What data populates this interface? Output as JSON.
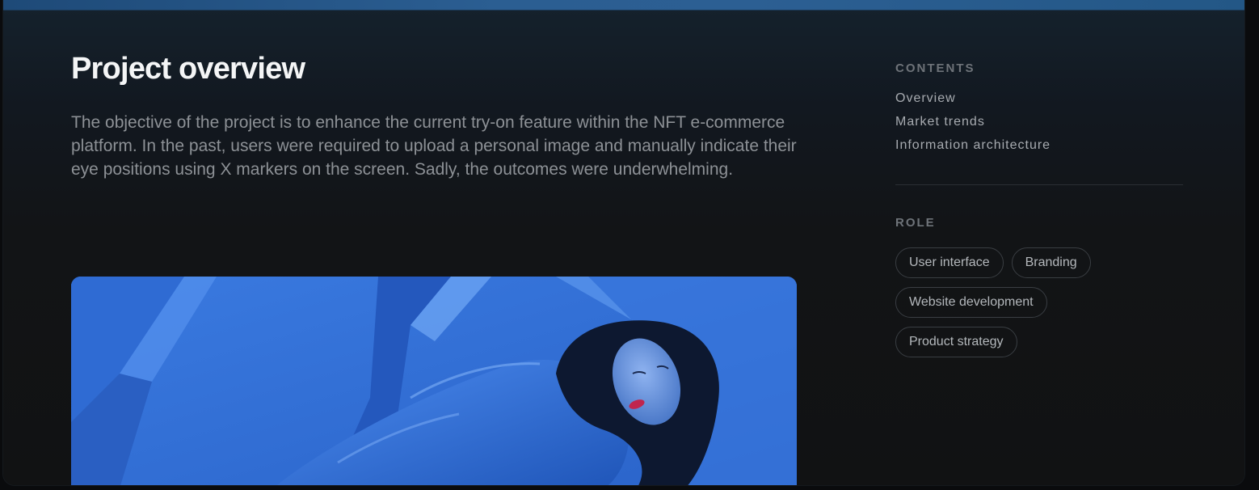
{
  "overview": {
    "title": "Project overview",
    "description": "The objective of the project is to enhance the current try-on feature within the NFT e-commerce platform. In the past, users were required to upload a personal image and manually indicate their eye positions using X markers on the screen. Sadly, the outcomes were underwhelming."
  },
  "sidebar": {
    "contents_label": "CONTENTS",
    "contents": [
      "Overview",
      "Market trends",
      "Information architecture"
    ],
    "role_label": "ROLE",
    "roles": [
      "User interface",
      "Branding",
      "Website development",
      "Product strategy"
    ]
  },
  "colors": {
    "accent_blue": "#2f6ed6",
    "top_bar": "#2b5e92",
    "background": "#121416"
  },
  "icons": {}
}
